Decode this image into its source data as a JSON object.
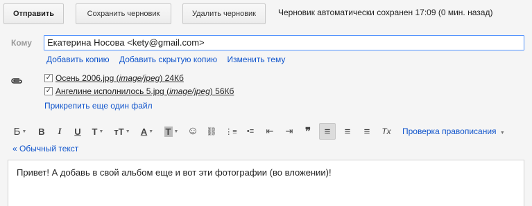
{
  "toolbar": {
    "send_label": "Отправить",
    "save_draft_label": "Сохранить черновик",
    "delete_draft_label": "Удалить черновик",
    "status_text": "Черновик автоматически сохранен 17:09 (0 мин. назад)"
  },
  "to": {
    "label": "Кому",
    "value": "Екатерина Носова <kety@gmail.com>"
  },
  "sublinks": {
    "add_cc": "Добавить копию",
    "add_bcc": "Добавить скрытую копию",
    "edit_subject": "Изменить тему"
  },
  "attachments": [
    {
      "name": "Осень 2006.jpg",
      "type": "image/jpeg",
      "size": "24Кб",
      "checked": true
    },
    {
      "name": "Ангелине исполнилось 5.jpg",
      "type": "image/jpeg",
      "size": "56Кб",
      "checked": true
    }
  ],
  "attach_more": "Прикрепить еще один файл",
  "format": {
    "font_glyph": "Б",
    "bold_glyph": "B",
    "italic_glyph": "I",
    "underline_glyph": "U",
    "font_face_glyph": "T",
    "font_size_glyph": "тT",
    "text_color_glyph": "A",
    "highlight_glyph": "T",
    "emoji_glyph": "☺",
    "link_glyph": "⛓",
    "numbered_glyph": "⋮≡",
    "bulleted_glyph": "•≡",
    "outdent_glyph": "⇤",
    "indent_glyph": "⇥",
    "quote_glyph": "❞",
    "align_left_glyph": "≡",
    "align_center_glyph": "≡",
    "align_right_glyph": "≡",
    "clear_format_glyph": "Tx",
    "spellcheck_label": "Проверка правописания",
    "caret": "▼"
  },
  "plain_text_link": "« Обычный текст",
  "message_body": "Привет! А добавь в свой альбом еще и вот эти фотографии (во вложении)!"
}
